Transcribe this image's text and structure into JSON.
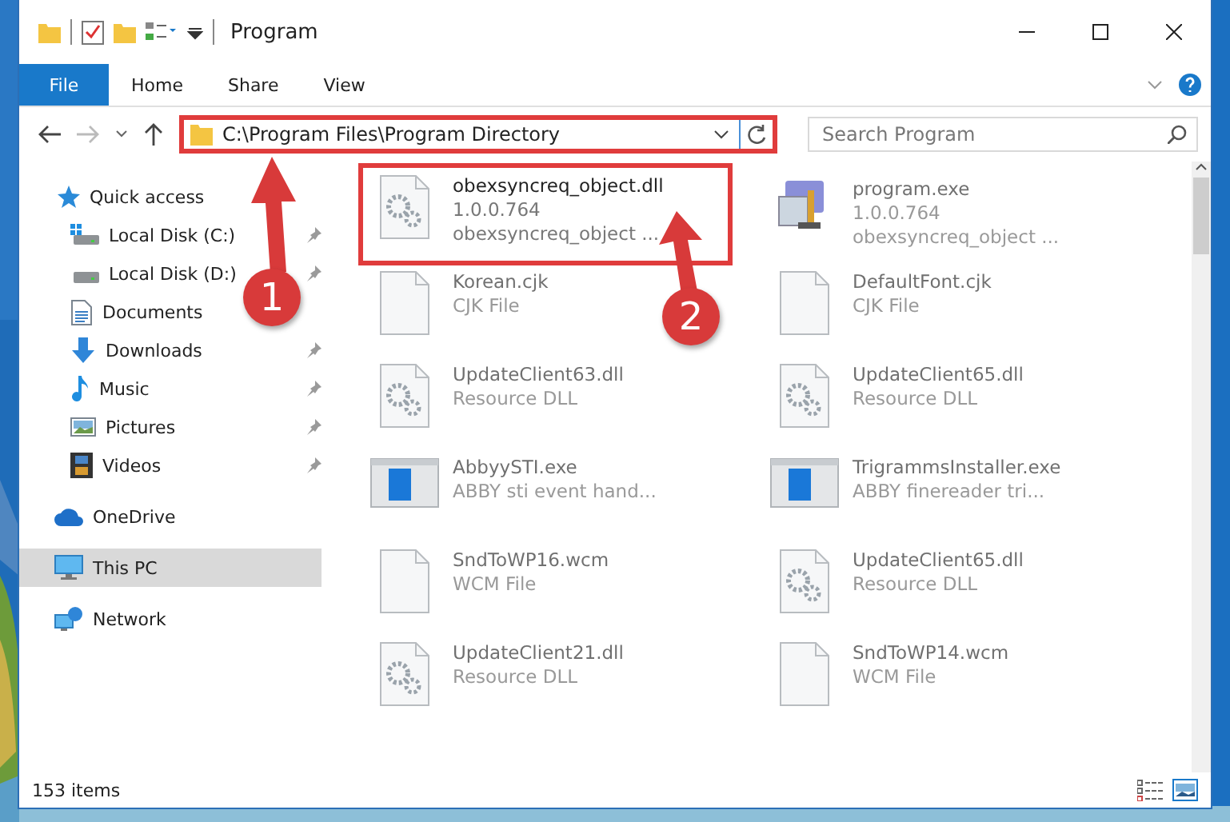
{
  "window": {
    "title": "Program"
  },
  "ribbon": {
    "file_tab": "File",
    "tabs": [
      "Home",
      "Share",
      "View"
    ]
  },
  "address_bar": {
    "path": "C:\\Program Files\\Program Directory",
    "highlighted": true
  },
  "search": {
    "placeholder": "Search Program"
  },
  "sidebar": {
    "items": [
      {
        "label": "Quick access",
        "selected": false,
        "children": [
          {
            "label": "Local Disk (C:)",
            "pinned": true,
            "selected": false
          },
          {
            "label": "Local Disk (D:)",
            "pinned": true,
            "selected": false
          },
          {
            "label": "Documents",
            "pinned": false,
            "selected": false
          },
          {
            "label": "Downloads",
            "pinned": true,
            "selected": false
          },
          {
            "label": "Music",
            "pinned": true,
            "selected": false
          },
          {
            "label": "Pictures",
            "pinned": true,
            "selected": false
          },
          {
            "label": "Videos",
            "pinned": true,
            "selected": false
          }
        ]
      },
      {
        "label": "OneDrive",
        "selected": false
      },
      {
        "label": "This PC",
        "selected": true
      },
      {
        "label": "Network",
        "selected": false
      }
    ]
  },
  "files": [
    {
      "name": "obexsyncreq_object.dll",
      "lines": [
        "1.0.0.764",
        "obexsyncreq_object ..."
      ],
      "kind": "gear",
      "highlighted": true
    },
    {
      "name": "program.exe",
      "lines": [
        "1.0.0.764",
        "obexsyncreq_object ..."
      ],
      "kind": "app",
      "highlighted": false
    },
    {
      "name": "Korean.cjk",
      "lines": [
        "CJK File"
      ],
      "kind": "blank",
      "highlighted": false
    },
    {
      "name": "DefaultFont.cjk",
      "lines": [
        "CJK File"
      ],
      "kind": "blank",
      "highlighted": false
    },
    {
      "name": "UpdateClient63.dll",
      "lines": [
        "Resource DLL"
      ],
      "kind": "gear",
      "highlighted": false
    },
    {
      "name": "UpdateClient65.dll",
      "lines": [
        "Resource DLL"
      ],
      "kind": "gear",
      "highlighted": false
    },
    {
      "name": "AbbyySTI.exe",
      "lines": [
        "ABBY sti event hand..."
      ],
      "kind": "window",
      "highlighted": false
    },
    {
      "name": "TrigrammsInstaller.exe",
      "lines": [
        "ABBY finereader tri..."
      ],
      "kind": "window",
      "highlighted": false
    },
    {
      "name": "SndToWP16.wcm",
      "lines": [
        "WCM File"
      ],
      "kind": "blank",
      "highlighted": false
    },
    {
      "name": "UpdateClient65.dll",
      "lines": [
        "Resource DLL"
      ],
      "kind": "gear",
      "highlighted": false
    },
    {
      "name": "UpdateClient21.dll",
      "lines": [
        "Resource DLL"
      ],
      "kind": "gear",
      "highlighted": false
    },
    {
      "name": "SndToWP14.wcm",
      "lines": [
        "WCM File"
      ],
      "kind": "blank",
      "highlighted": false
    }
  ],
  "status_bar": {
    "item_count": "153 items"
  },
  "callouts": [
    {
      "number": "1"
    },
    {
      "number": "2"
    }
  ]
}
